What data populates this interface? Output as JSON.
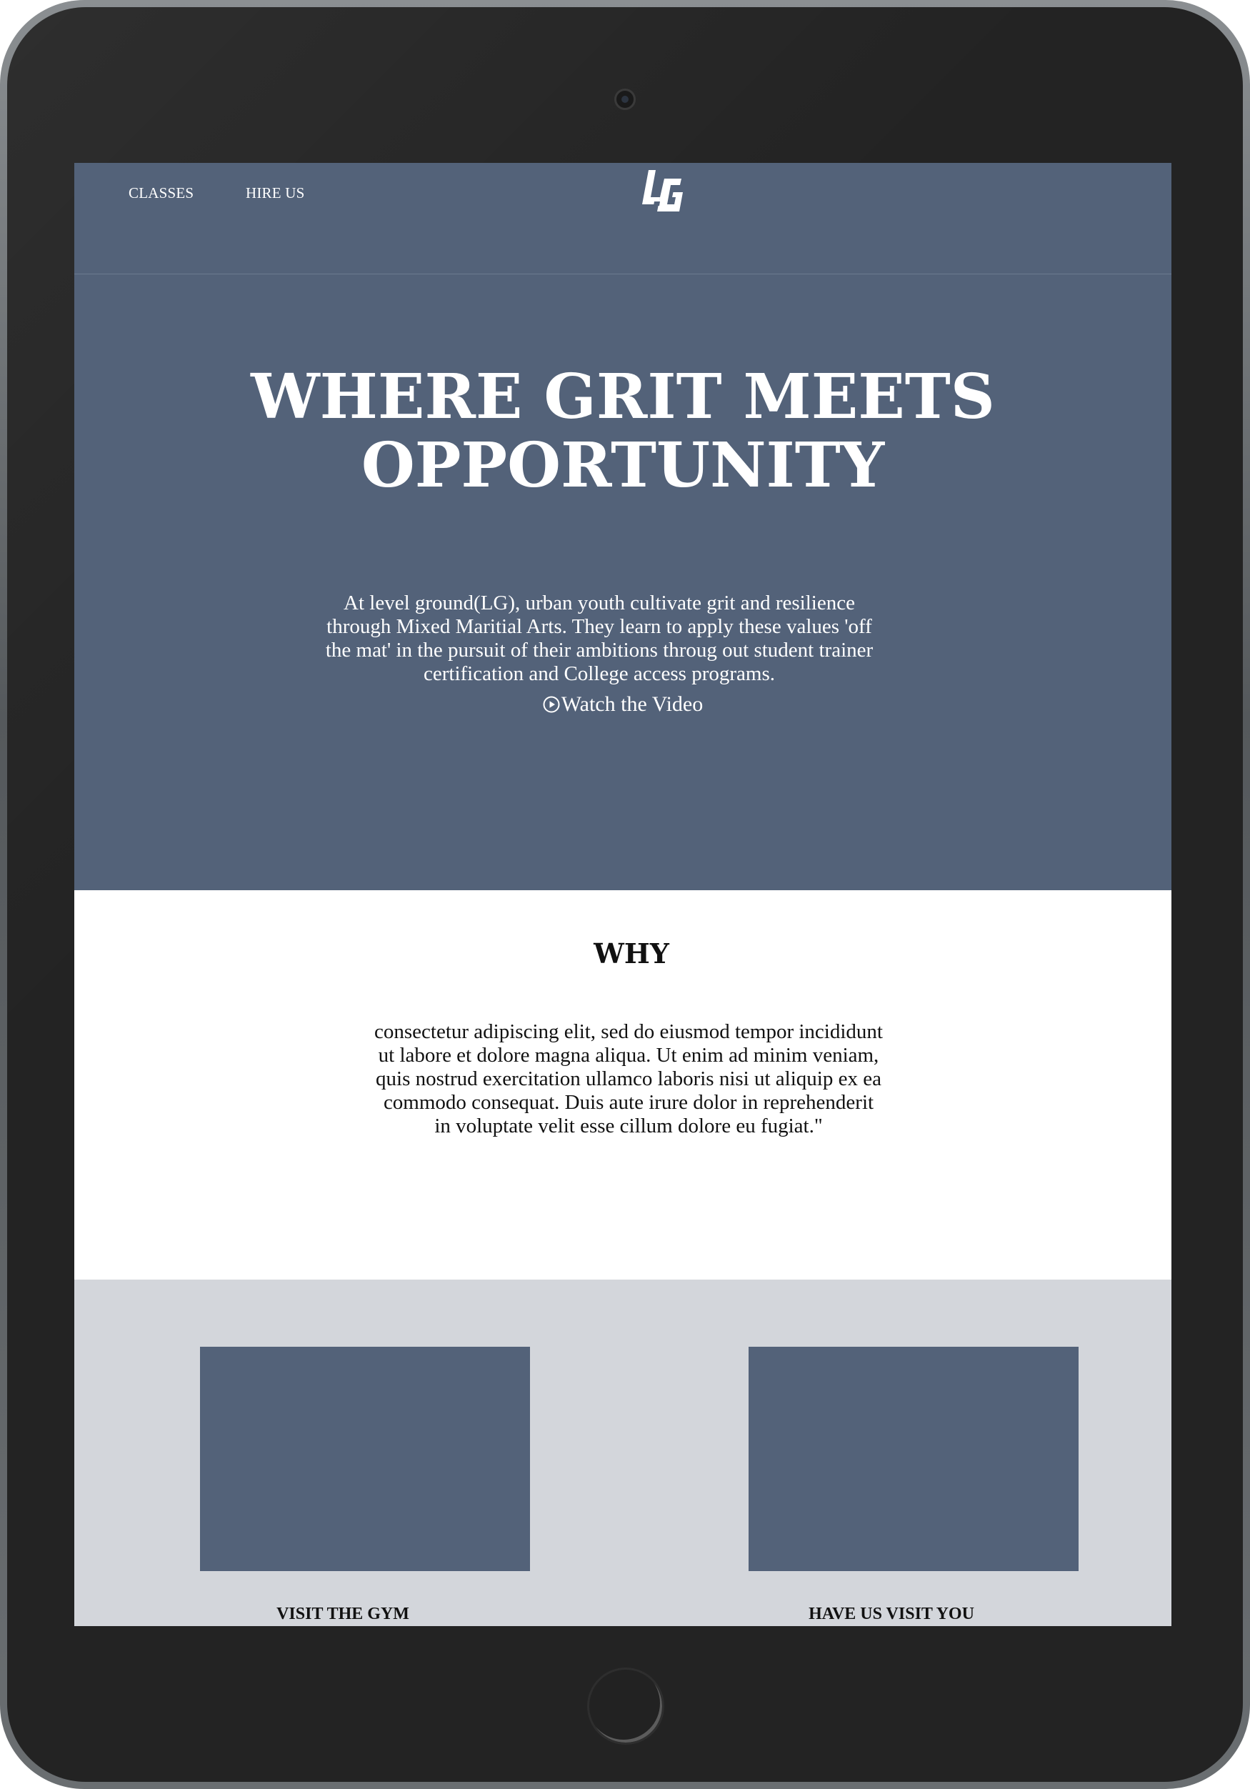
{
  "nav": {
    "classes_label": "CLASSES",
    "hire_label": "HIRE US",
    "logo_text": "LG"
  },
  "hero": {
    "title_line1": "WHERE GRIT MEETS",
    "title_line2": "OPPORTUNITY",
    "body": "At level ground(LG), urban youth cultivate grit and resilience through Mixed Maritial Arts. They learn to apply these values 'off the mat' in the pursuit of their ambitions throug out student trainer certification and College access programs.",
    "watch_label": "Watch the Video",
    "watch_icon": "play-circle-icon"
  },
  "why": {
    "title": "WHY",
    "body": "consectetur adipiscing elit, sed do eiusmod tempor incididunt ut labore et dolore magna aliqua. Ut enim ad minim veniam, quis nostrud exercitation ullamco laboris nisi ut aliquip ex ea commodo consequat. Duis aute irure dolor in reprehenderit in voluptate velit esse cillum dolore eu fugiat.\""
  },
  "cards": [
    {
      "label": "VISIT THE GYM"
    },
    {
      "label": "HAVE US VISIT YOU"
    }
  ],
  "colors": {
    "brand_slate": "#536279",
    "cards_background": "#d3d6db",
    "device_body": "#232323"
  }
}
